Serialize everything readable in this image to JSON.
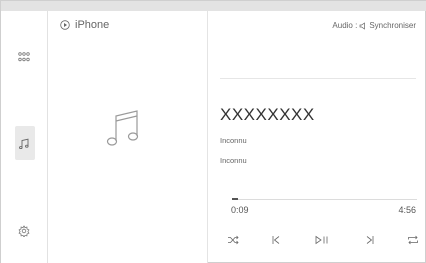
{
  "source": {
    "label": "iPhone"
  },
  "audio": {
    "label": "Audio : ",
    "sync_label": "Synchroniser"
  },
  "track": {
    "title": "XXXXXXXX",
    "artist": "Inconnu",
    "album": "Inconnu"
  },
  "playback": {
    "elapsed": "0:09",
    "total": "4:56",
    "progress_fraction": 0.03
  },
  "sidebar": {
    "items": [
      {
        "icon": "apps-grid-icon"
      },
      {
        "icon": "music-note-icon",
        "active": true
      },
      {
        "icon": "settings-gear-icon"
      }
    ]
  },
  "controls": [
    {
      "icon": "shuffle-icon"
    },
    {
      "icon": "previous-track-icon"
    },
    {
      "icon": "play-pause-icon"
    },
    {
      "icon": "next-track-icon"
    },
    {
      "icon": "repeat-icon"
    }
  ],
  "colors": {
    "accent": "#555555",
    "background": "#ffffff",
    "divider": "#e6e6e6"
  }
}
